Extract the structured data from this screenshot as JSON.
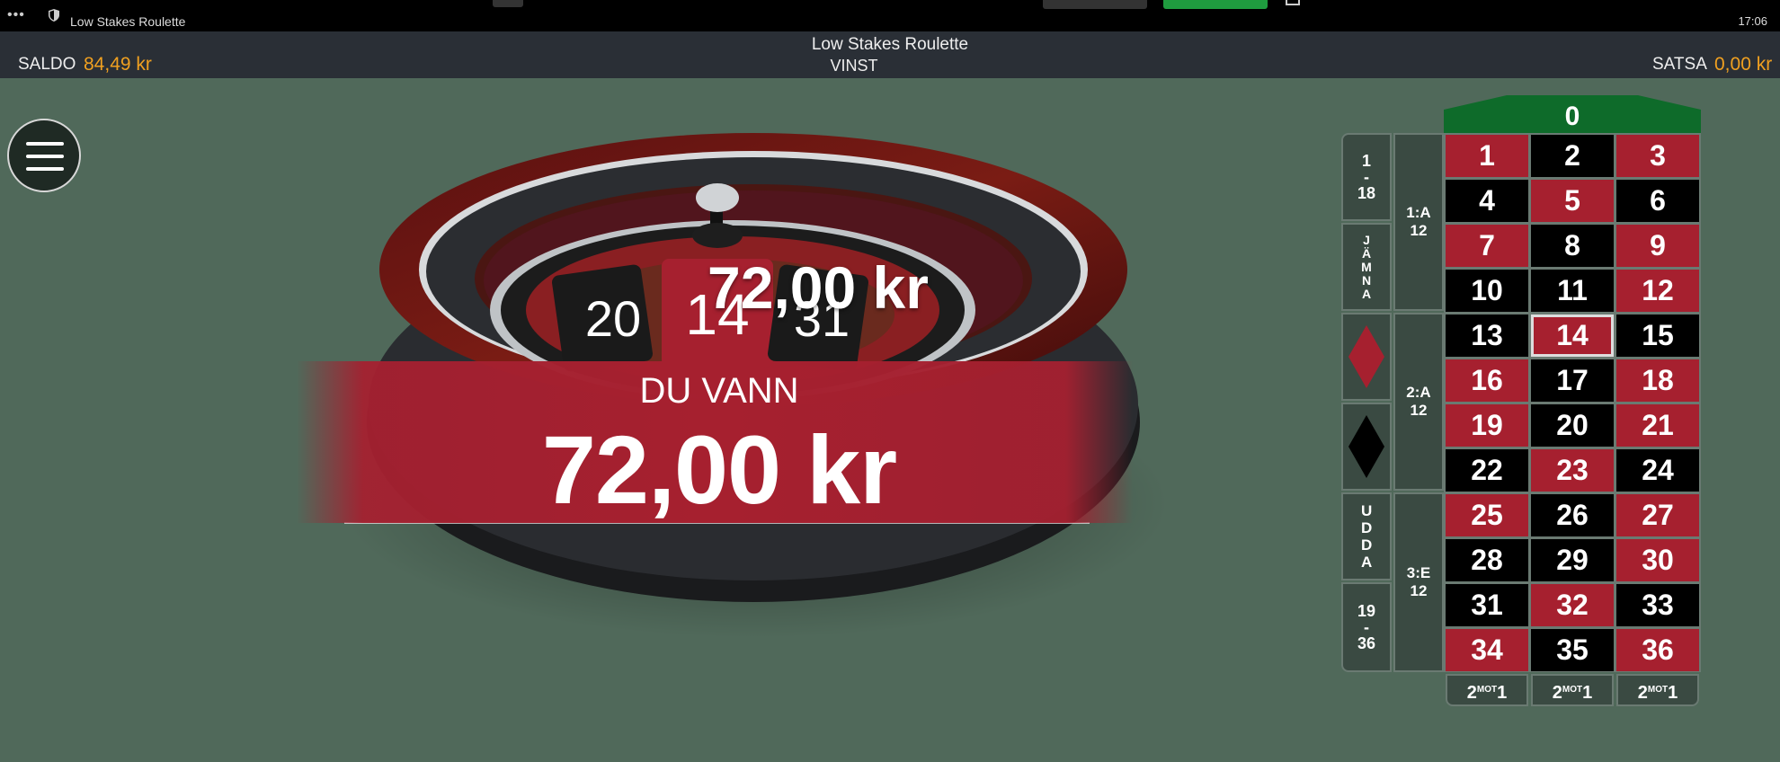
{
  "browser": {
    "tab_title": "Low Stakes Roulette",
    "clock": "17:06"
  },
  "header": {
    "game_title": "Low Stakes Roulette",
    "win_label": "VINST",
    "balance_label": "SALDO",
    "balance_value": "84,49 kr",
    "bet_label": "SATSA",
    "bet_value": "0,00 kr"
  },
  "result": {
    "title": "DU VANN",
    "amount": "72,00 kr",
    "overlay_amount": "72,00 kr",
    "recent_numbers": [
      "20",
      "14",
      "31"
    ]
  },
  "board": {
    "zero": "0",
    "numbers": [
      {
        "n": "1",
        "color": "red"
      },
      {
        "n": "2",
        "color": "black"
      },
      {
        "n": "3",
        "color": "red"
      },
      {
        "n": "4",
        "color": "black"
      },
      {
        "n": "5",
        "color": "red"
      },
      {
        "n": "6",
        "color": "black"
      },
      {
        "n": "7",
        "color": "red"
      },
      {
        "n": "8",
        "color": "black"
      },
      {
        "n": "9",
        "color": "red"
      },
      {
        "n": "10",
        "color": "black"
      },
      {
        "n": "11",
        "color": "black"
      },
      {
        "n": "12",
        "color": "red"
      },
      {
        "n": "13",
        "color": "black"
      },
      {
        "n": "14",
        "color": "red"
      },
      {
        "n": "15",
        "color": "black"
      },
      {
        "n": "16",
        "color": "red"
      },
      {
        "n": "17",
        "color": "black"
      },
      {
        "n": "18",
        "color": "red"
      },
      {
        "n": "19",
        "color": "red"
      },
      {
        "n": "20",
        "color": "black"
      },
      {
        "n": "21",
        "color": "red"
      },
      {
        "n": "22",
        "color": "black"
      },
      {
        "n": "23",
        "color": "red"
      },
      {
        "n": "24",
        "color": "black"
      },
      {
        "n": "25",
        "color": "red"
      },
      {
        "n": "26",
        "color": "black"
      },
      {
        "n": "27",
        "color": "red"
      },
      {
        "n": "28",
        "color": "black"
      },
      {
        "n": "29",
        "color": "black"
      },
      {
        "n": "30",
        "color": "red"
      },
      {
        "n": "31",
        "color": "black"
      },
      {
        "n": "32",
        "color": "red"
      },
      {
        "n": "33",
        "color": "black"
      },
      {
        "n": "34",
        "color": "red"
      },
      {
        "n": "35",
        "color": "black"
      },
      {
        "n": "36",
        "color": "red"
      }
    ],
    "highlighted_number": "14",
    "dozens": [
      "1:A 12",
      "2:A 12",
      "3:E 12"
    ],
    "low": "1 - 18",
    "even": "JÄMNA",
    "odd": "UDDA",
    "high": "19 - 36",
    "column_bet": {
      "prefix": "2",
      "mid": "MOT",
      "suffix": "1"
    }
  },
  "colors": {
    "felt": "#50695a",
    "red": "#a6202f",
    "black": "#000000",
    "accent": "#f0a020",
    "zero_green": "#0e6b2a"
  }
}
